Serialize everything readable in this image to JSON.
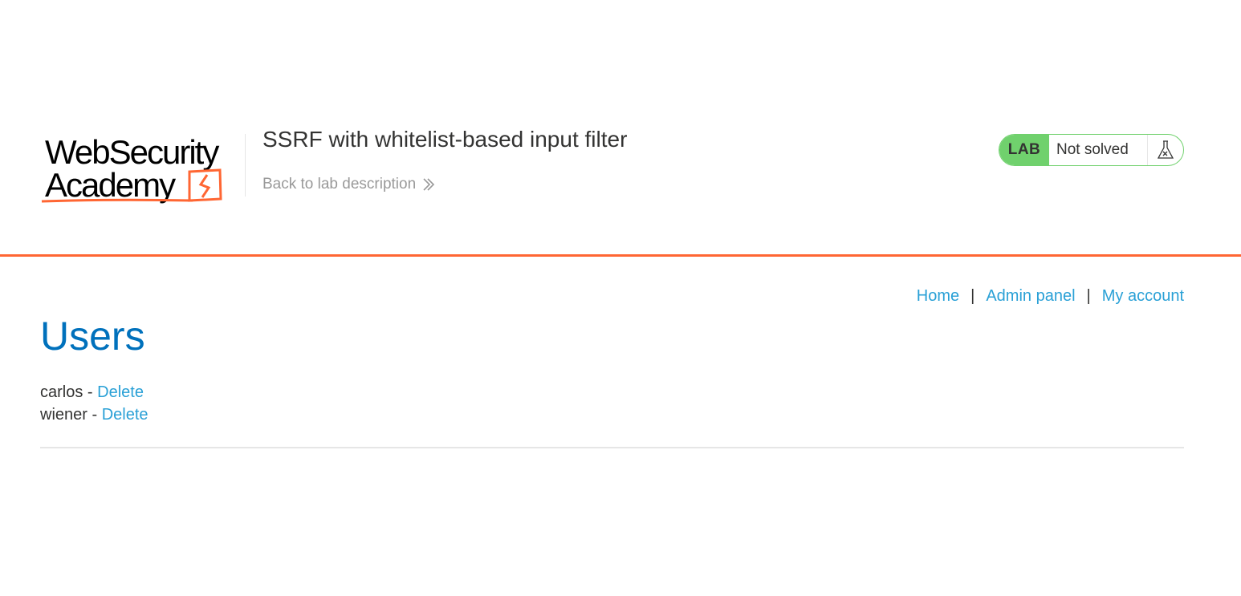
{
  "header": {
    "logo_line1": "WebSecurity",
    "logo_line2": "Academy",
    "lab_title": "SSRF with whitelist-based input filter",
    "back_link": "Back to lab description",
    "status": {
      "tag": "LAB",
      "text": "Not solved",
      "icon": "flask-icon",
      "color": "#70d16d"
    },
    "accent_color": "#ff6633"
  },
  "nav": {
    "home": "Home",
    "admin_panel": "Admin panel",
    "my_account": "My account",
    "separator": "|"
  },
  "main": {
    "heading": "Users",
    "users": [
      {
        "name": "carlos",
        "separator": " - ",
        "action": "Delete"
      },
      {
        "name": "wiener",
        "separator": " - ",
        "action": "Delete"
      }
    ]
  }
}
